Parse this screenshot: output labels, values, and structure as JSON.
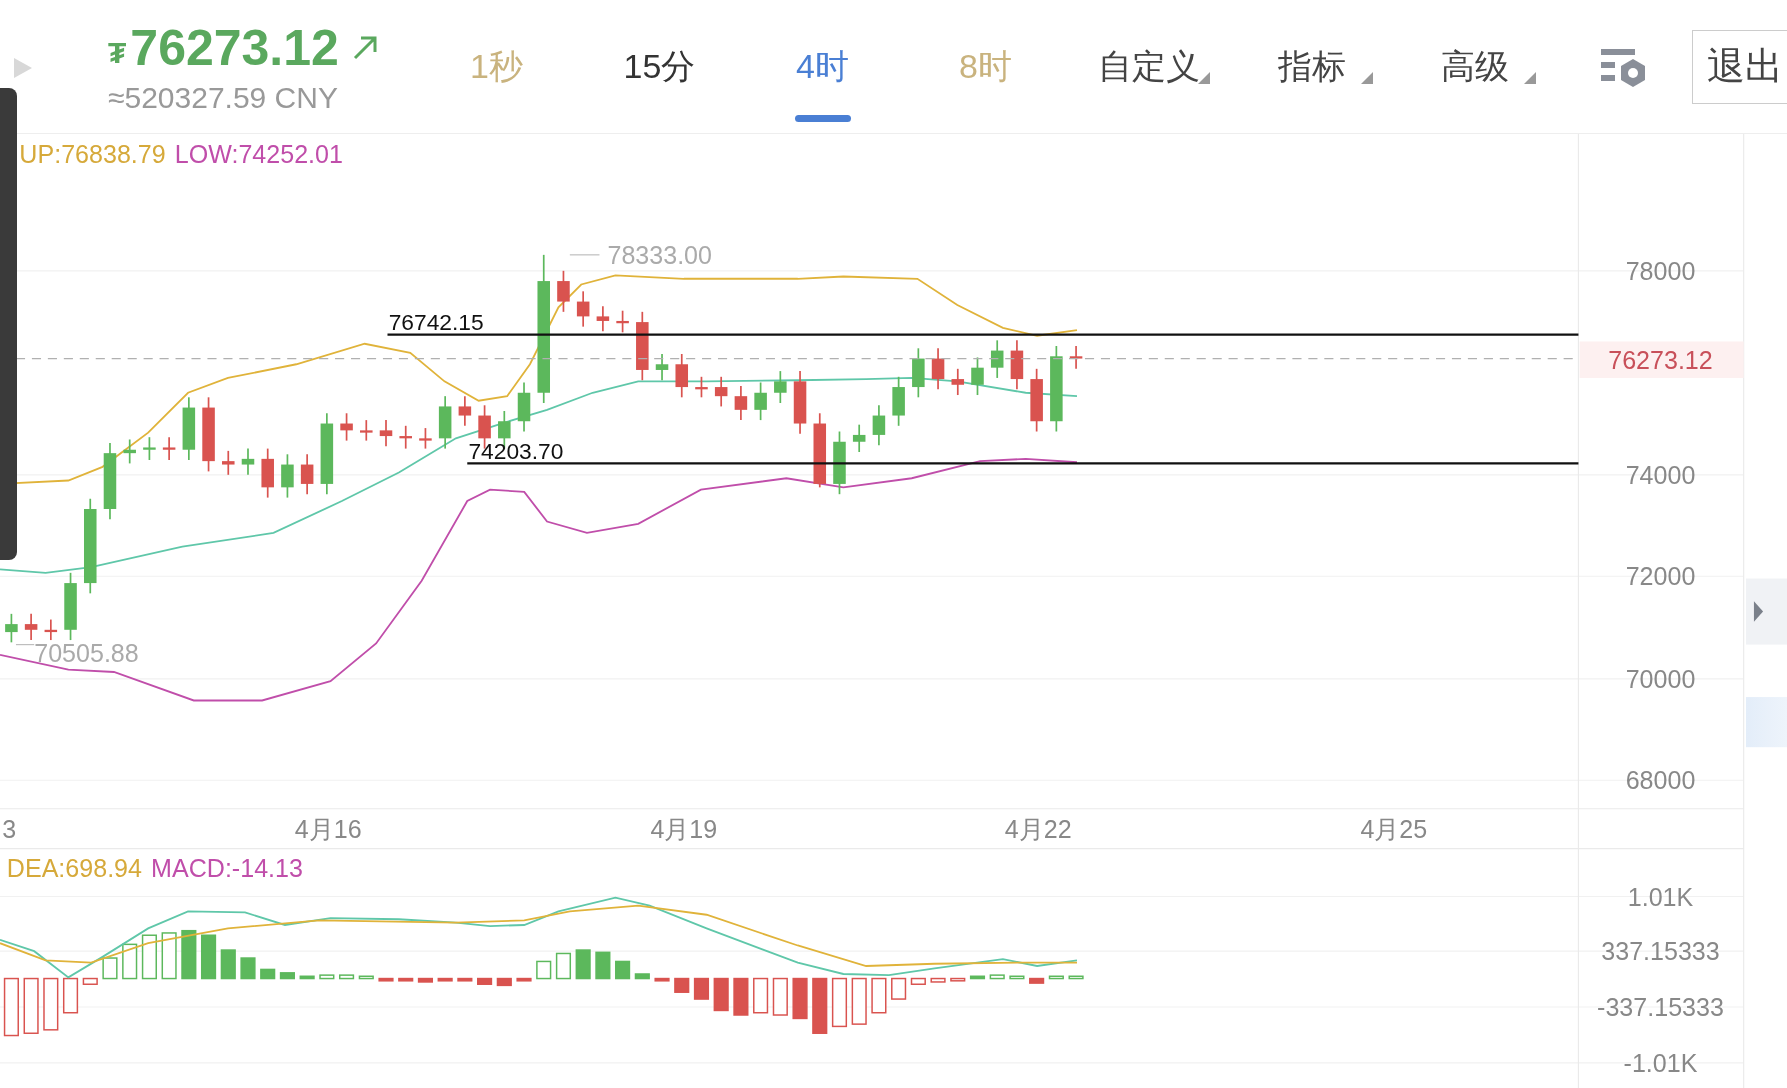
{
  "header": {
    "currency_symbol": "₮",
    "price": "76273.12",
    "converted": "≈520327.59 CNY"
  },
  "tabs": [
    {
      "label": "1秒",
      "kind": "plain",
      "color": "#c9b37e",
      "selected": false
    },
    {
      "label": "15分",
      "kind": "plain",
      "color": "#333333",
      "selected": false
    },
    {
      "label": "4时",
      "kind": "plain",
      "color": "#4a7fd4",
      "selected": true
    },
    {
      "label": "8时",
      "kind": "plain",
      "color": "#c9b37e",
      "selected": false
    },
    {
      "label": "自定义",
      "kind": "dropdown",
      "color": "#444444",
      "selected": false
    },
    {
      "label": "指标",
      "kind": "dropdown",
      "color": "#444444",
      "selected": false
    },
    {
      "label": "高级",
      "kind": "dropdown",
      "color": "#444444",
      "selected": false
    }
  ],
  "exit_button": "退出",
  "main_chart": {
    "legend": [
      {
        "text": "UP:76838.79",
        "color": "#d6a93a"
      },
      {
        "text": "LOW:74252.01",
        "color": "#c04eaa"
      }
    ],
    "high_label": "78333.00",
    "low_label": "70505.88",
    "levels": [
      {
        "label": "76742.15"
      },
      {
        "label": "74203.70"
      }
    ],
    "current_price": "76273.12",
    "y_ticks": [
      "78000",
      "74000",
      "72000",
      "70000",
      "68000"
    ],
    "x_labels": [
      "3",
      "4月16",
      "4月19",
      "4月22",
      "4月25"
    ]
  },
  "macd": {
    "legend": [
      {
        "text": "DEA:698.94",
        "color": "#d6a93a"
      },
      {
        "text": "MACD:-14.13",
        "color": "#c04eaa"
      }
    ],
    "y_ticks": [
      "1.01K",
      "337.15333",
      "-337.15333",
      "-1.01K"
    ]
  }
}
